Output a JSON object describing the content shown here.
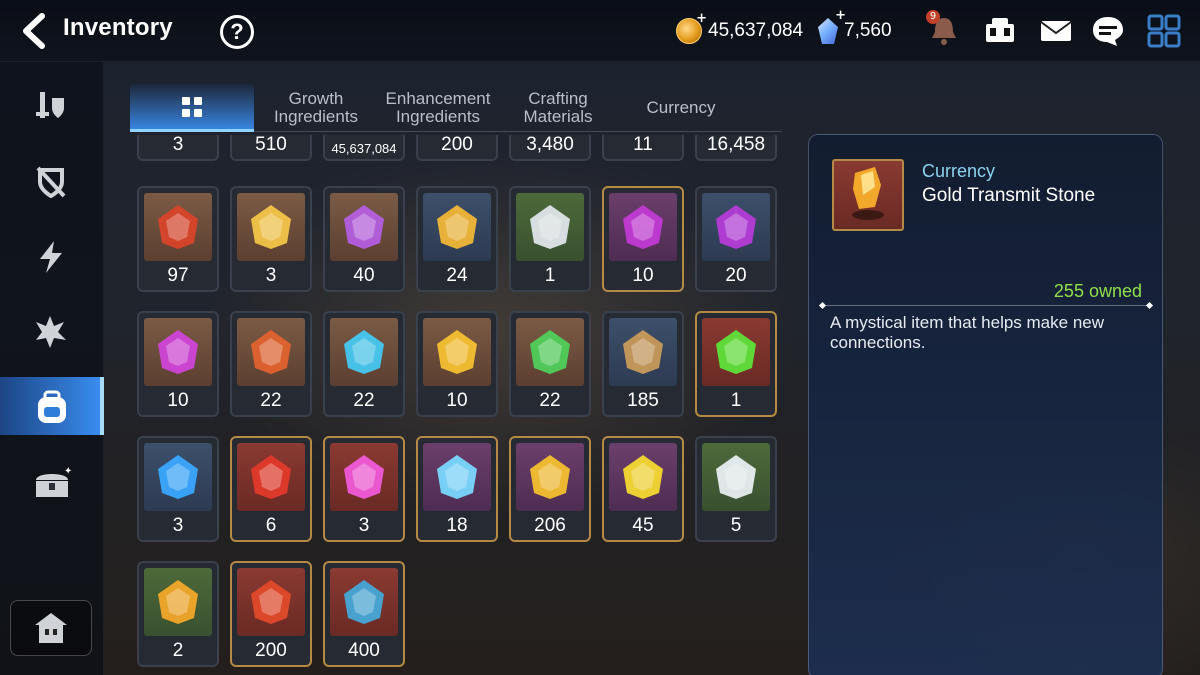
{
  "header": {
    "title": "Inventory",
    "help_label": "?",
    "gold": "45,637,084",
    "crystals": "7,560",
    "bell_badge": "9",
    "plus": "+"
  },
  "tabs": [
    {
      "label": "",
      "icon": "grid-icon",
      "active": true
    },
    {
      "label": "Growth\nIngredients"
    },
    {
      "label": "Enhancement\nIngredients"
    },
    {
      "label": "Crafting\nMaterials"
    },
    {
      "label": "Currency"
    }
  ],
  "items_row0": [
    "3",
    "510",
    "45,637,084",
    "200",
    "3,480",
    "11",
    "16,458"
  ],
  "items": [
    {
      "count": "97",
      "icon": "red-leaf-icon",
      "bg": "brown"
    },
    {
      "count": "3",
      "icon": "chicken-icon",
      "bg": "brown"
    },
    {
      "count": "40",
      "icon": "purple-flower-icon",
      "bg": "brown"
    },
    {
      "count": "24",
      "icon": "gold-flower-icon",
      "bg": "blue"
    },
    {
      "count": "1",
      "icon": "silver-flower-icon",
      "bg": "green"
    },
    {
      "count": "10",
      "icon": "purple-moon-gem-icon",
      "bg": "purple"
    },
    {
      "count": "20",
      "icon": "purple-shard-icon",
      "bg": "blue"
    },
    {
      "count": "10",
      "icon": "purple-rune-icon",
      "bg": "brown"
    },
    {
      "count": "22",
      "icon": "fire-rune-icon",
      "bg": "brown"
    },
    {
      "count": "22",
      "icon": "ice-rune-icon",
      "bg": "brown"
    },
    {
      "count": "10",
      "icon": "light-rune-icon",
      "bg": "brown"
    },
    {
      "count": "22",
      "icon": "earth-rune-icon",
      "bg": "brown"
    },
    {
      "count": "185",
      "icon": "herb-root-icon",
      "bg": "blue"
    },
    {
      "count": "1",
      "icon": "green-orb-icon",
      "bg": "red"
    },
    {
      "count": "3",
      "icon": "blue-portal-icon",
      "bg": "blue"
    },
    {
      "count": "6",
      "icon": "red-crystal-icon",
      "bg": "red"
    },
    {
      "count": "3",
      "icon": "potion-icon",
      "bg": "red"
    },
    {
      "count": "18",
      "icon": "purple-crystal-icon",
      "bg": "purple"
    },
    {
      "count": "206",
      "icon": "gold-t-stone-icon",
      "bg": "purple"
    },
    {
      "count": "45",
      "icon": "lightning-stone-icon",
      "bg": "purple"
    },
    {
      "count": "5",
      "icon": "white-stone-icon",
      "bg": "green"
    },
    {
      "count": "2",
      "icon": "gold-t-rock-icon",
      "bg": "green"
    },
    {
      "count": "200",
      "icon": "red-shard-icon",
      "bg": "red"
    },
    {
      "count": "400",
      "icon": "blue-shard-icon",
      "bg": "red"
    }
  ],
  "detail": {
    "category": "Currency",
    "name": "Gold Transmit Stone",
    "owned": "255 owned",
    "description": "A mystical item that helps make new connections."
  },
  "nav": [
    "equipment-icon",
    "no-shield-icon",
    "lightning-icon",
    "burst-icon",
    "backpack-icon",
    "chest-icon",
    "house-icon"
  ],
  "colors": {
    "accent": "#3c96ff",
    "owned_green": "#8fe04a",
    "category_blue": "#8cd2ee"
  }
}
